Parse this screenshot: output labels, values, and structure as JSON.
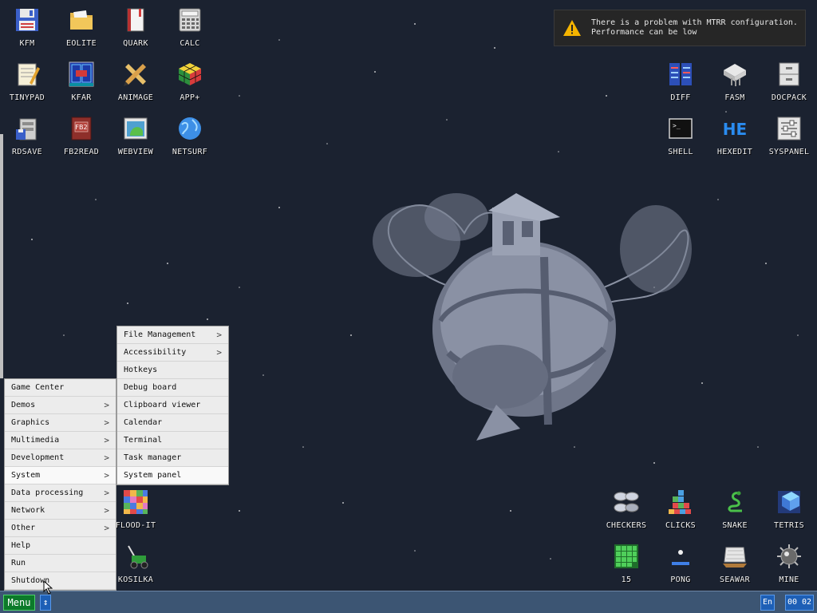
{
  "notification": {
    "line1": "There is a problem with MTRR configuration.",
    "line2": "Performance can be low"
  },
  "desktop_icons": {
    "kfm": "KFM",
    "eolite": "EOLITE",
    "quark": "QUARK",
    "calc": "CALC",
    "tinypad": "TINYPAD",
    "kfar": "KFAR",
    "animage": "ANIMAGE",
    "app_plus": "APP+",
    "rdsave": "RDSAVE",
    "fb2read": "FB2READ",
    "webview": "WEBVIEW",
    "netsurf": "NETSURF",
    "diff": "DIFF",
    "fasm": "FASM",
    "docpack": "DOCPACK",
    "shell": "SHELL",
    "hexedit": "HEXEDIT",
    "syspanel": "SYSPANEL",
    "flood_it": "FLOOD-IT",
    "kosilka": "KOSILKA",
    "checkers": "CHECKERS",
    "clicks": "CLICKS",
    "snake": "SNAKE",
    "tetris": "TETRIS",
    "fifteen": "15",
    "pong": "PONG",
    "seawar": "SEAWAR",
    "mine": "MINE"
  },
  "icon_glyphs": {
    "fb2": "FB2",
    "he": "HE",
    "shell_prompt": ">_"
  },
  "main_menu": {
    "game_center": "Game Center",
    "demos": "Demos",
    "graphics": "Graphics",
    "multimedia": "Multimedia",
    "development": "Development",
    "system": "System",
    "data_processing": "Data processing",
    "network": "Network",
    "other": "Other",
    "help": "Help",
    "run": "Run",
    "shutdown": "Shutdown"
  },
  "system_submenu": {
    "file_management": "File Management",
    "accessibility": "Accessibility",
    "hotkeys": "Hotkeys",
    "debug_board": "Debug board",
    "clipboard_viewer": "Clipboard viewer",
    "calendar": "Calendar",
    "terminal": "Terminal",
    "task_manager": "Task manager",
    "system_panel": "System panel"
  },
  "submenu_arrow": ">",
  "taskbar": {
    "menu_label": "Menu",
    "switch_glyph": "↕",
    "language": "En",
    "clock": "00 02"
  },
  "colors": {
    "desktop_bg": "#1b2230",
    "taskbar_bg": "#3c5573",
    "menu_button": "#0c7a2a",
    "tray_button": "#1d5fb6",
    "menu_bg": "#ececec"
  }
}
